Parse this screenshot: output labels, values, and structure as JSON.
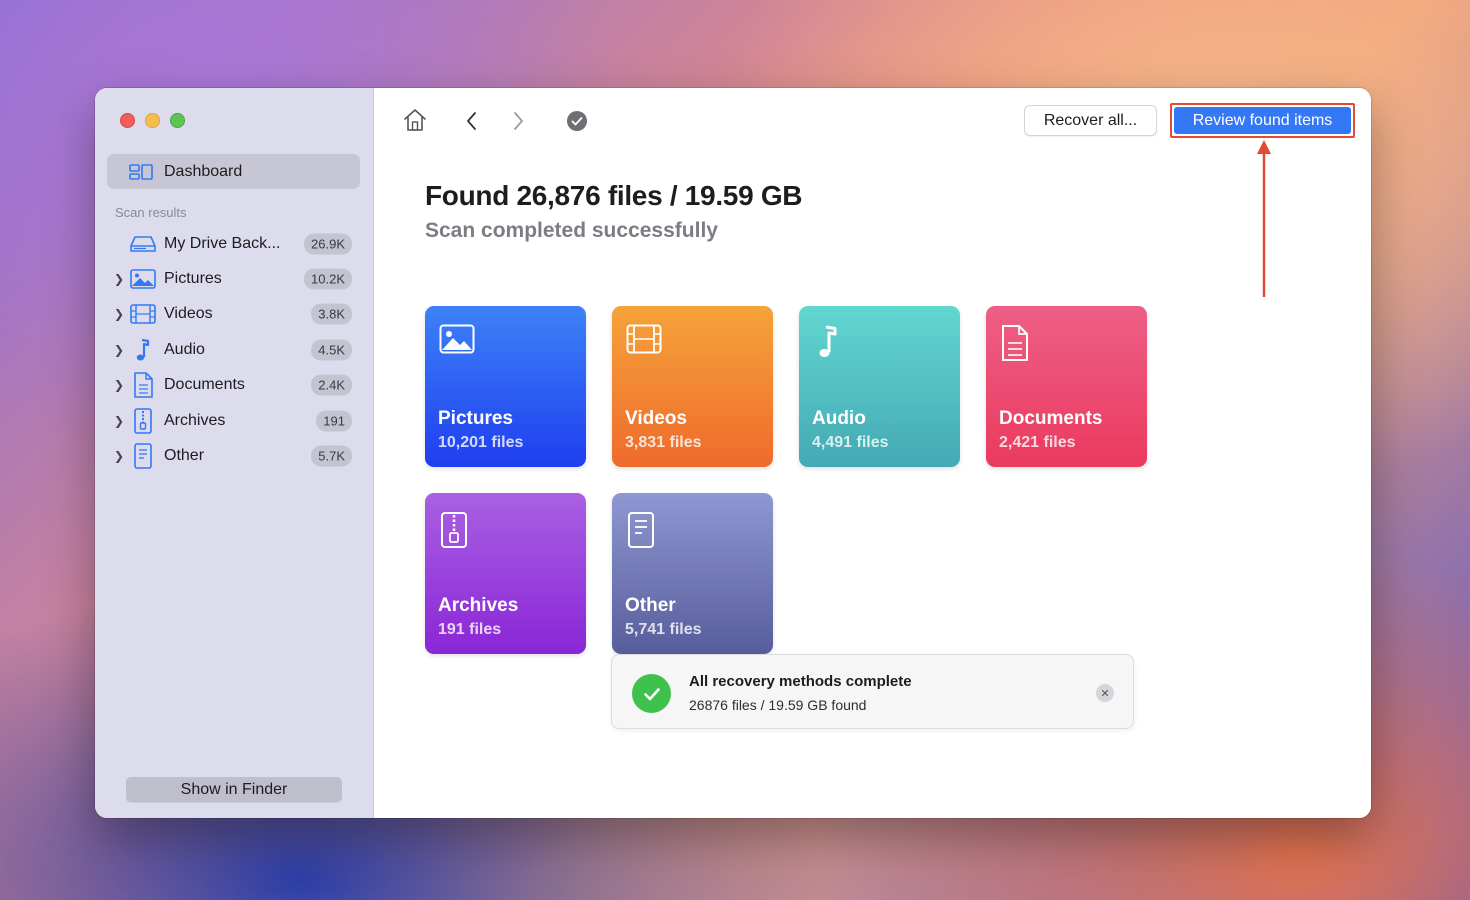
{
  "sidebar": {
    "dashboard_label": "Dashboard",
    "section_label": "Scan results",
    "items": [
      {
        "label": "My Drive Back...",
        "badge": "26.9K",
        "icon": "drive-icon",
        "expandable": false
      },
      {
        "label": "Pictures",
        "badge": "10.2K",
        "icon": "pictures-icon",
        "expandable": true
      },
      {
        "label": "Videos",
        "badge": "3.8K",
        "icon": "videos-icon",
        "expandable": true
      },
      {
        "label": "Audio",
        "badge": "4.5K",
        "icon": "audio-icon",
        "expandable": true
      },
      {
        "label": "Documents",
        "badge": "2.4K",
        "icon": "documents-icon",
        "expandable": true
      },
      {
        "label": "Archives",
        "badge": "191",
        "icon": "archives-icon",
        "expandable": true
      },
      {
        "label": "Other",
        "badge": "5.7K",
        "icon": "other-icon",
        "expandable": true
      }
    ],
    "show_in_finder_label": "Show in Finder"
  },
  "toolbar": {
    "recover_all_label": "Recover all...",
    "review_label": "Review found items"
  },
  "header": {
    "title": "Found 26,876 files / 19.59 GB",
    "subtitle": "Scan completed successfully"
  },
  "cards": [
    {
      "name": "Pictures",
      "count": "10,201 files",
      "icon": "pictures-icon",
      "color": "#2f5bf0"
    },
    {
      "name": "Videos",
      "count": "3,831 files",
      "icon": "videos-icon",
      "color": "#f2873a"
    },
    {
      "name": "Audio",
      "count": "4,491 files",
      "icon": "audio-icon",
      "color": "#52c3c4"
    },
    {
      "name": "Documents",
      "count": "2,421 files",
      "icon": "documents-icon",
      "color": "#ec4f72"
    },
    {
      "name": "Archives",
      "count": "191 files",
      "icon": "archives-icon",
      "color": "#9a3fdc"
    },
    {
      "name": "Other",
      "count": "5,741 files",
      "icon": "other-icon",
      "color": "#6c73b3"
    }
  ],
  "toast": {
    "title": "All recovery methods complete",
    "subtitle": "26876 files / 19.59 GB found"
  }
}
